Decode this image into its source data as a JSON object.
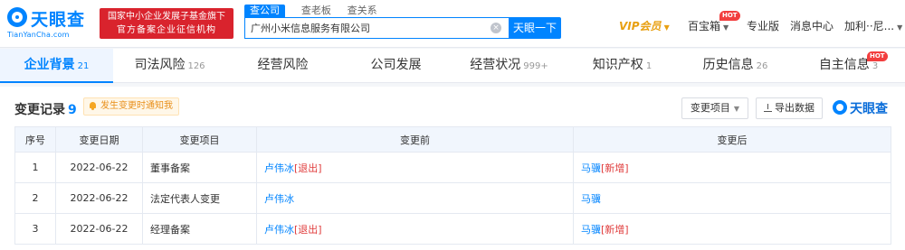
{
  "header": {
    "logo_text": "天眼查",
    "logo_domain": "TianYanCha.com",
    "gov_badge_line1": "国家中小企业发展子基金旗下",
    "gov_badge_line2": "官方备案企业征信机构",
    "search_tabs": [
      "查公司",
      "查老板",
      "查关系"
    ],
    "search_value": "广州小米信息服务有限公司",
    "search_button": "天眼一下",
    "vip_label": "VIP会员",
    "baibaoxiang": "百宝箱",
    "hot": "HOT",
    "zhuanye": "专业版",
    "messages": "消息中心",
    "user": "加利··尼..."
  },
  "categories": [
    {
      "label": "企业背景",
      "count": "21"
    },
    {
      "label": "司法风险",
      "count": "126"
    },
    {
      "label": "经营风险",
      "count": ""
    },
    {
      "label": "公司发展",
      "count": ""
    },
    {
      "label": "经营状况",
      "count": "999+"
    },
    {
      "label": "知识产权",
      "count": "1"
    },
    {
      "label": "历史信息",
      "count": "26"
    },
    {
      "label": "自主信息",
      "count": "3"
    }
  ],
  "section": {
    "title": "变更记录",
    "count": "9",
    "notify": "发生变更时通知我",
    "filter_label": "变更项目",
    "export_label": "导出数据",
    "brand": "天眼查"
  },
  "table": {
    "headers": [
      "序号",
      "变更日期",
      "变更项目",
      "变更前",
      "变更后"
    ],
    "rows": [
      {
        "idx": "1",
        "date": "2022-06-22",
        "item": "董事备案",
        "before_name": "卢伟冰",
        "before_tag": "[退出]",
        "after_name": "马骥",
        "after_tag": "[新增]"
      },
      {
        "idx": "2",
        "date": "2022-06-22",
        "item": "法定代表人变更",
        "before_name": "卢伟冰",
        "before_tag": "",
        "after_name": "马骥",
        "after_tag": ""
      },
      {
        "idx": "3",
        "date": "2022-06-22",
        "item": "经理备案",
        "before_name": "卢伟冰",
        "before_tag": "[退出]",
        "after_name": "马骥",
        "after_tag": "[新增]"
      }
    ]
  },
  "colors": {
    "brand_blue": "#0084ff",
    "gov_red": "#d9232d",
    "vip_gold": "#e8a012",
    "tag_red": "#e03c3c"
  }
}
